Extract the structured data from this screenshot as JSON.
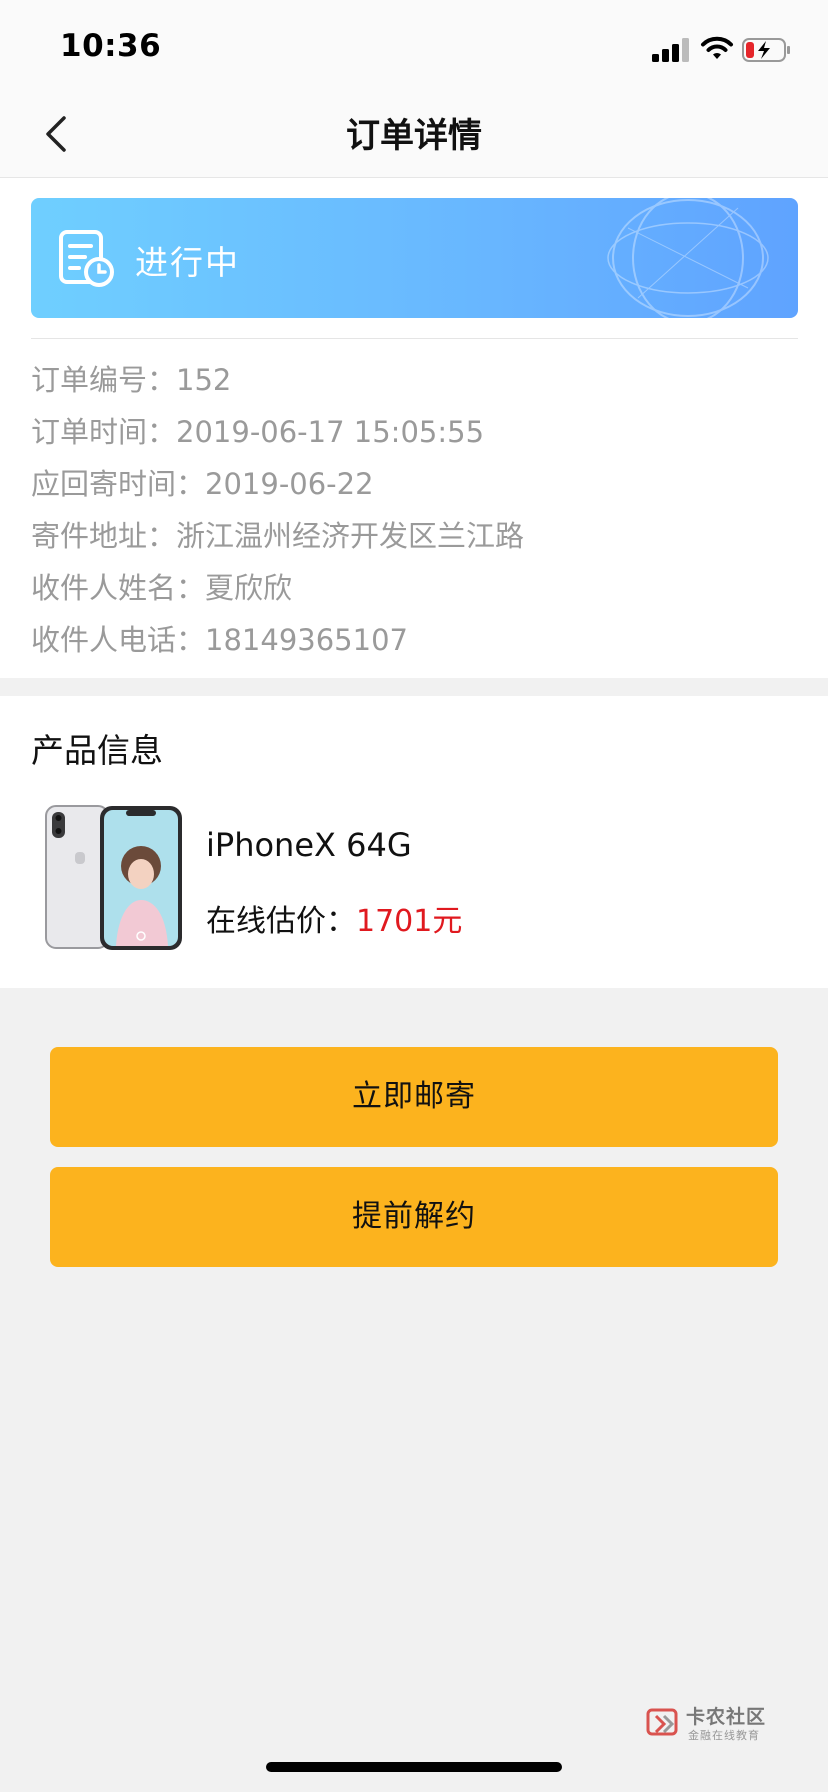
{
  "status_bar": {
    "time": "10:36"
  },
  "nav": {
    "title": "订单详情"
  },
  "banner": {
    "status": "进行中",
    "color_start": "#6fcfff",
    "color_end": "#5fa3ff"
  },
  "order_info": [
    {
      "label": "订单编号：",
      "value": "152"
    },
    {
      "label": "订单时间：",
      "value": "2019-06-17 15:05:55"
    },
    {
      "label": "应回寄时间：",
      "value": "2019-06-22"
    },
    {
      "label": "寄件地址：",
      "value": "浙江温州经济开发区兰江路"
    },
    {
      "label": "收件人姓名：",
      "value": "夏欣欣"
    },
    {
      "label": "收件人电话：",
      "value": "18149365107"
    }
  ],
  "product": {
    "section_title": "产品信息",
    "name": "iPhoneX 64G",
    "price_label": "在线估价：",
    "price_value": "1701元",
    "price_color": "#e0191f"
  },
  "actions": {
    "mail_label": "立即邮寄",
    "cancel_label": "提前解约",
    "button_color": "#fcb31e"
  },
  "watermark": {
    "main": "卡农社区",
    "sub": "金融在线教育"
  }
}
